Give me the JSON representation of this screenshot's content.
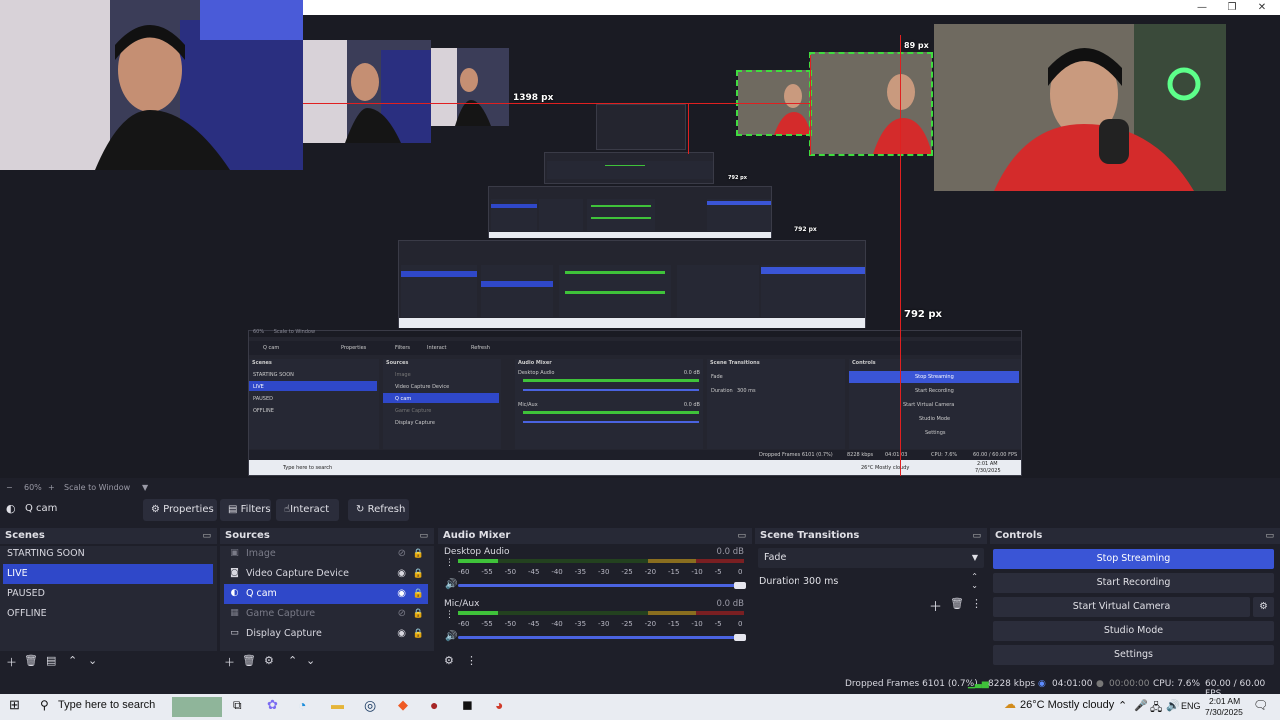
{
  "window": {
    "minimize_glyph": "—",
    "restore_glyph": "❐",
    "close_glyph": "✕"
  },
  "preview": {
    "measure_labels": [
      "792 px",
      "792 px",
      "792 px",
      "1398 px",
      "89 px"
    ],
    "inner_scenes": [
      "STARTING SOON",
      "LIVE",
      "PAUSED",
      "OFFLINE"
    ],
    "inner_sources": [
      "Image",
      "Video Capture Device",
      "Q cam",
      "Game Capture",
      "Display Capture"
    ],
    "inner_controls": [
      "Stop Streaming",
      "Start Recording",
      "Start Virtual Camera",
      "Studio Mode",
      "Settings"
    ],
    "inner_source_name": "Q cam",
    "inner_buttons": [
      "Properties",
      "Filters",
      "Interact",
      "Refresh"
    ],
    "inner_mixer_title": "Audio Mixer",
    "inner_transitions_title": "Scene Transitions",
    "inner_transition": "Fade",
    "inner_duration_label": "Duration",
    "inner_duration": "300 ms",
    "inner_desktop_audio": "Desktop Audio",
    "inner_micaux": "Mic/Aux",
    "inner_status": "Dropped Frames 6101 (0.7%)",
    "inner_kbps": "8228 kbps",
    "inner_time": "04:01:03",
    "inner_cpu": "CPU: 7.6%",
    "inner_fps": "60.00 / 60.00 FPS",
    "inner_search": "Type here to search",
    "inner_weather": "26°C  Mostly cloudy",
    "inner_clock": "2:01 AM",
    "inner_date": "7/30/2025",
    "inner_zoom": "60%",
    "inner_scale": "Scale to Window",
    "inner_scenes_title": "Scenes",
    "inner_sources_title": "Sources",
    "inner_controls_title": "Controls",
    "inner_db": "0.0 dB"
  },
  "zoombar": {
    "zoom": "60%",
    "scale": "Scale to Window"
  },
  "source_toolbar": {
    "source_name": "Q cam",
    "buttons": [
      "Properties",
      "Filters",
      "Interact",
      "Refresh"
    ]
  },
  "scenes": {
    "title": "Scenes",
    "items": [
      "STARTING SOON",
      "LIVE",
      "PAUSED",
      "OFFLINE"
    ],
    "selected": "LIVE"
  },
  "sources": {
    "title": "Sources",
    "items": [
      {
        "name": "Image",
        "icon": "image-icon"
      },
      {
        "name": "Video Capture Device",
        "icon": "camera-icon"
      },
      {
        "name": "Q cam",
        "icon": "browser-icon"
      },
      {
        "name": "Game Capture",
        "icon": "gamepad-icon"
      },
      {
        "name": "Display Capture",
        "icon": "monitor-icon"
      }
    ],
    "selected": "Q cam"
  },
  "mixer": {
    "title": "Audio Mixer",
    "channels": [
      {
        "name": "Desktop Audio",
        "db": "0.0 dB",
        "level": 0.14
      },
      {
        "name": "Mic/Aux",
        "db": "0.0 dB",
        "level": 0.14
      }
    ],
    "ticks": [
      "-60",
      "-55",
      "-50",
      "-45",
      "-40",
      "-35",
      "-30",
      "-25",
      "-20",
      "-15",
      "-10",
      "-5",
      "0"
    ]
  },
  "transitions": {
    "title": "Scene Transitions",
    "selected": "Fade",
    "duration_label": "Duration",
    "duration": "300 ms"
  },
  "controls": {
    "title": "Controls",
    "buttons": [
      "Stop Streaming",
      "Start Recording",
      "Start Virtual Camera",
      "Studio Mode",
      "Settings"
    ]
  },
  "status": {
    "dropped": "Dropped Frames 6101 (0.7%)",
    "kbps": "8228 kbps",
    "stream_time": "04:01:00",
    "rec_time": "00:00:00",
    "cpu": "CPU: 7.6%",
    "fps": "60.00 / 60.00 FPS"
  },
  "taskbar": {
    "search_placeholder": "Type here to search",
    "weather": "26°C  Mostly cloudy",
    "lang": "ENG",
    "time": "2:01 AM",
    "date": "7/30/2025"
  },
  "colors": {
    "accent": "#2f48c9",
    "measure_red": "#e02020",
    "snap_green": "#3fdc3f",
    "meter_green": "#3fc23a"
  }
}
